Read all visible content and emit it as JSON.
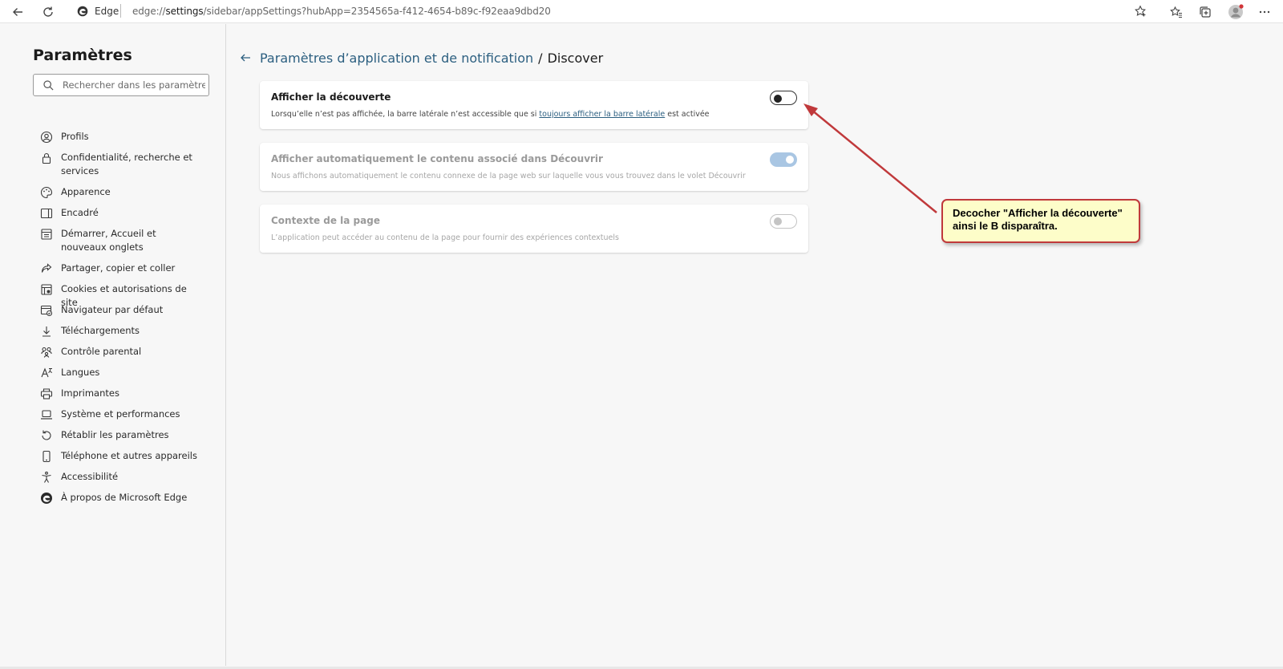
{
  "browser": {
    "site_name": "Edge",
    "url_prefix": "edge://",
    "url_host": "settings",
    "url_path": "/sidebar/appSettings?hubApp=2354565a-f412-4654-b89c-f92eaa9dbd20"
  },
  "sidebar": {
    "title": "Paramètres",
    "search_placeholder": "Rechercher dans les paramètres",
    "items": [
      {
        "label": "Profils",
        "icon": "profile-icon"
      },
      {
        "label": "Confidentialité, recherche et services",
        "icon": "lock-icon"
      },
      {
        "label": "Apparence",
        "icon": "appearance-icon"
      },
      {
        "label": "Encadré",
        "icon": "sidebar-panel-icon"
      },
      {
        "label": "Démarrer, Accueil et nouveaux onglets",
        "icon": "home-tabs-icon"
      },
      {
        "label": "Partager, copier et coller",
        "icon": "share-icon"
      },
      {
        "label": "Cookies et autorisations de site",
        "icon": "cookies-icon"
      },
      {
        "label": "Navigateur par défaut",
        "icon": "default-browser-icon"
      },
      {
        "label": "Téléchargements",
        "icon": "download-icon"
      },
      {
        "label": "Contrôle parental",
        "icon": "family-icon"
      },
      {
        "label": "Langues",
        "icon": "language-icon"
      },
      {
        "label": "Imprimantes",
        "icon": "printer-icon"
      },
      {
        "label": "Système et performances",
        "icon": "laptop-icon"
      },
      {
        "label": "Rétablir les paramètres",
        "icon": "reset-icon"
      },
      {
        "label": "Téléphone et autres appareils",
        "icon": "phone-icon"
      },
      {
        "label": "Accessibilité",
        "icon": "accessibility-icon"
      },
      {
        "label": "À propos de Microsoft Edge",
        "icon": "edge-logo-icon"
      }
    ]
  },
  "breadcrumb": {
    "parent": "Paramètres d’application et de notification",
    "separator": "/",
    "current": "Discover"
  },
  "settings": [
    {
      "title": "Afficher la découverte",
      "desc_before": "Lorsqu’elle n’est pas affichée, la barre latérale n’est accessible que si ",
      "desc_link": "toujours afficher la barre latérale",
      "desc_after": " est activée",
      "toggle": "off"
    },
    {
      "title": "Afficher automatiquement le contenu associé dans Découvrir",
      "desc": "Nous affichons automatiquement le contenu connexe de la page web sur laquelle vous vous trouvez dans le volet Découvrir",
      "toggle": "on-disabled"
    },
    {
      "title": "Contexte de la page",
      "desc": "L’application peut accéder au contenu de la page pour fournir des expériences contextuels",
      "toggle": "off-disabled"
    }
  ],
  "annotation": {
    "line1": "Decocher \"Afficher la découverte\"",
    "line2": "ainsi le B disparaîtra.",
    "color": "#c0393b"
  },
  "colors": {
    "link": "#2c5f80",
    "toggle_on_disabled": "#a9c6e3"
  }
}
